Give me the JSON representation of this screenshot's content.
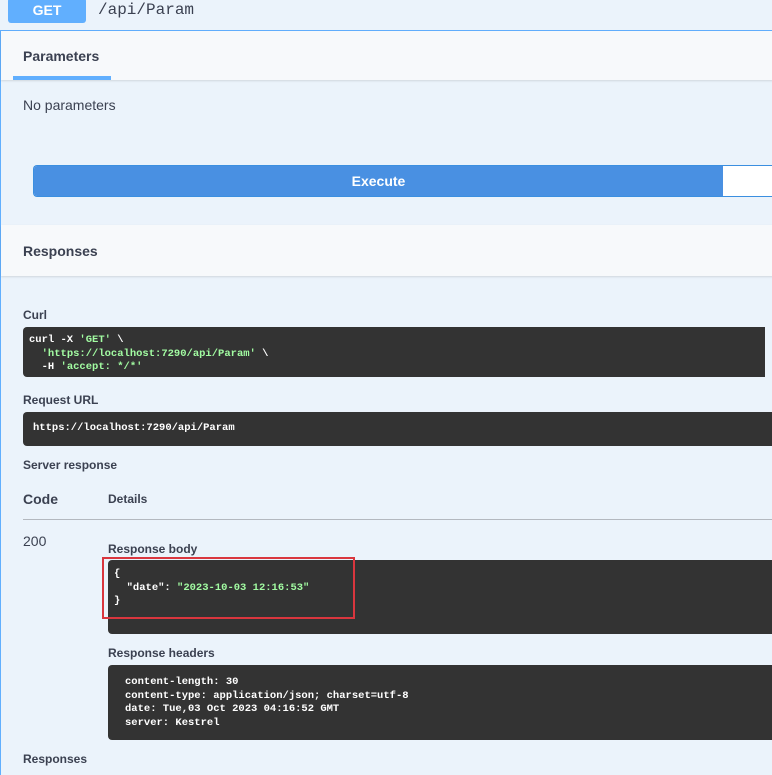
{
  "operation": {
    "method": "GET",
    "path": "/api/Param"
  },
  "parameters": {
    "tab_label": "Parameters",
    "empty_text": "No parameters"
  },
  "execute": {
    "label": "Execute"
  },
  "responses_header": "Responses",
  "curl": {
    "label": "Curl",
    "line1": "curl -X ",
    "line1_str": "'GET'",
    "line1_end": " \\",
    "line2_str": "'https://localhost:7290/api/Param'",
    "line2_end": " \\",
    "line3_pre": "-H ",
    "line3_str": "'accept: */*'"
  },
  "request_url": {
    "label": "Request URL",
    "value": "https://localhost:7290/api/Param"
  },
  "server_response": {
    "label": "Server response",
    "col_code": "Code",
    "col_details": "Details",
    "code": "200",
    "body_label": "Response body",
    "body_open": "{",
    "body_key": "\"date\":",
    "body_value": "\"2023-10-03 12:16:53\"",
    "body_close": "}",
    "headers_label": "Response headers",
    "headers": [
      "content-length: 30",
      "content-type: application/json; charset=utf-8",
      "date: Tue,03 Oct 2023 04:16:52 GMT",
      "server: Kestrel"
    ]
  },
  "responses_footer": "Responses",
  "colors": {
    "get": "#61affe",
    "execute": "#4990e2",
    "highlight": "#d9363e",
    "code_bg": "#333333",
    "string": "#a2fca2"
  }
}
